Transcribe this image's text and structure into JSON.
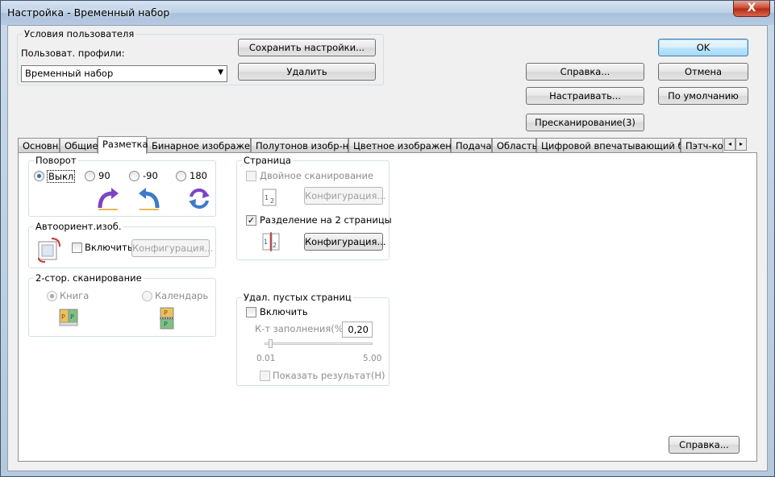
{
  "window": {
    "title": "Настройка - Временный набор",
    "close_glyph": "X"
  },
  "user_settings": {
    "group_title": "Условия пользователя",
    "profile_label": "Пользоват. профили:",
    "profile_value": "Временный набор",
    "save_button": "Сохранить настройки...",
    "delete_button": "Удалить"
  },
  "right_buttons": {
    "ok": "OK",
    "cancel": "Отмена",
    "help": "Справка...",
    "configure": "Настраивать...",
    "default": "По умолчанию",
    "prescan": "Пресканирование(3)"
  },
  "tabs": [
    "Основн.",
    "Общие",
    "Разметка",
    "Бинарное изображение",
    "Полутонов изобр-ние",
    "Цветное изображение",
    "Подача",
    "Область",
    "Цифровой впечатывающий блок",
    "Пэтч-код"
  ],
  "tab_scroll": {
    "left": "◂",
    "right": "▸"
  },
  "rotation": {
    "title": "Поворот",
    "options": [
      "Выкл",
      "90",
      "-90",
      "180"
    ],
    "selected": "Выкл"
  },
  "auto_orient": {
    "title": "Автоориент.изоб.",
    "enable_label": "Включить",
    "config_button": "Конфигурация..."
  },
  "duplex": {
    "title": "2-стор. сканирование",
    "options": [
      "Книга",
      "Календарь"
    ],
    "selected": "Книга"
  },
  "page": {
    "title": "Страница",
    "double_scan_label": "Двойное сканирование",
    "double_scan_config": "Конфигурация...",
    "split_label": "Разделение на 2 страницы",
    "split_checked": "✓",
    "split_config": "Конфигурация..."
  },
  "blank_pages": {
    "title": "Удал. пустых страниц",
    "enable_label": "Включить",
    "fill_label": "К-т заполнения(%):",
    "fill_value": "0,20",
    "slider_min": "0.01",
    "slider_max": "5.00",
    "slider_value": 0.2,
    "show_result_label": "Показать результат(H)"
  },
  "panel_help_button": "Справка...",
  "colors": {
    "titlebar": "#bcd0e6",
    "close": "#c7432a",
    "active_blue": "#2e6fbf"
  }
}
